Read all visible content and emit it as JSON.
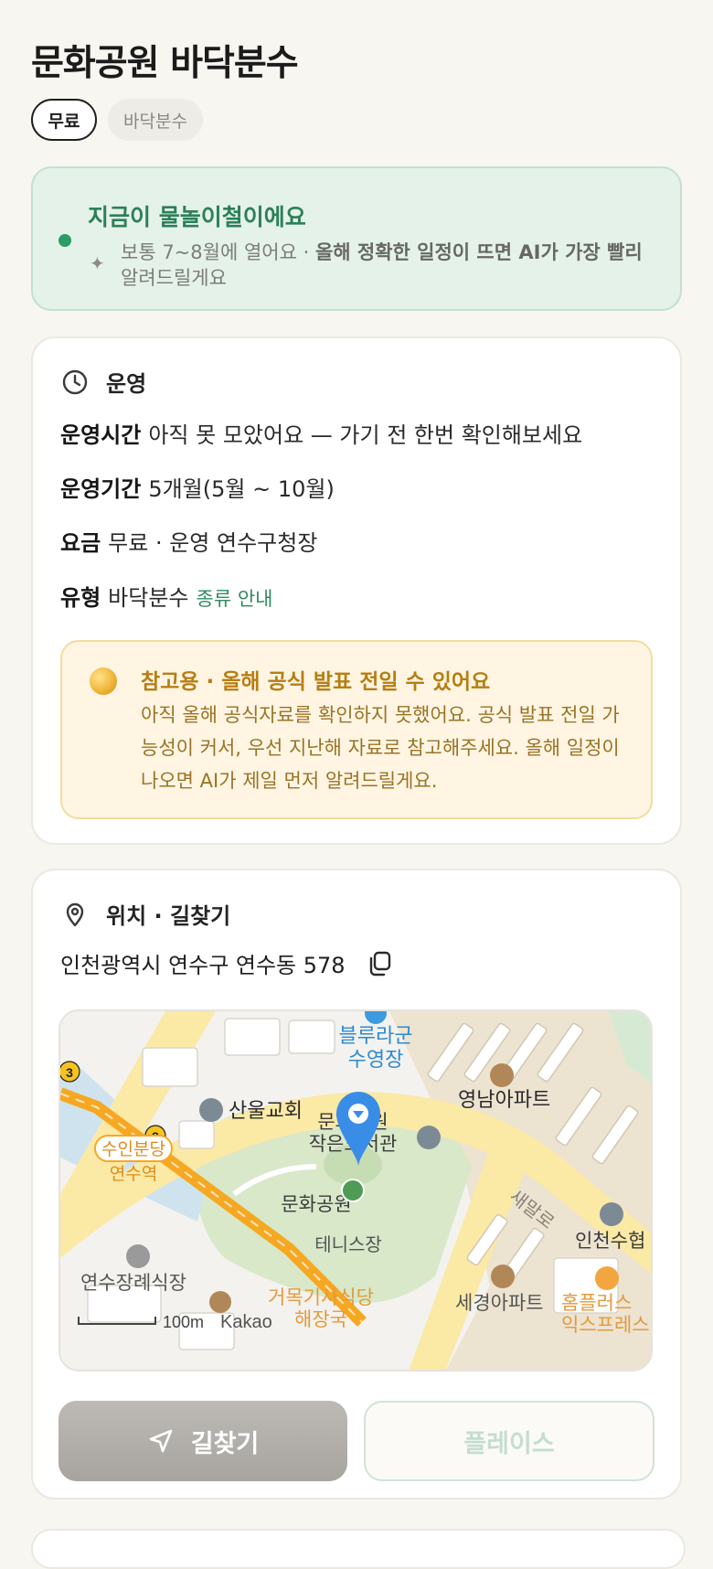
{
  "header": {
    "title": "문화공원 바닥분수",
    "chips": {
      "price": "무료",
      "type": "바닥분수"
    }
  },
  "season": {
    "title": "지금이 물놀이철이에요",
    "desc_prefix": "보통 7~8월에 열어요 · ",
    "desc_emphasis": "올해 정확한 일정이 뜨면 AI가 가장 빨리",
    "desc_suffix": " 알려드릴게요",
    "accent_color": "#2f9b68"
  },
  "operation": {
    "heading": "운영",
    "hours_label": "운영시간",
    "hours_value": "아직 못 모았어요 — 가기 전 한번 확인해보세요",
    "period_label": "운영기간",
    "period_value": "5개월(5월 ~ 10월)",
    "fee_label": "요금",
    "fee_value": "무료 · 운영 연수구청장",
    "type_label": "유형",
    "type_value": "바닥분수",
    "type_link": "종류 안내",
    "notice_title": "참고용 · 올해 공식 발표 전일 수 있어요",
    "notice_body": "아직 올해 공식자료를 확인하지 못했어요. 공식 발표 전일 가능성이 커서, 우선 지난해 자료로 참고해주세요. 올해 일정이 나오면 AI가 제일 먼저 알려드릴게요."
  },
  "location": {
    "heading": "위치 · 길찾기",
    "address": "인천광역시 연수구 연수동 578",
    "map_labels": {
      "pool": "블루라군 수영장",
      "church": "산울교회",
      "library": "문화공원 작은도서관",
      "park": "문화공원",
      "tennis": "테니스장",
      "apt1": "영남아파트",
      "apt2": "세경아파트",
      "road": "새말로",
      "station": "수인분당 연수역",
      "funeral": "연수장례식장",
      "market": "거목기사식당 해장국",
      "office": "인천수협",
      "store": "홈플러스 익스프레스",
      "scale": "100m",
      "brand": "Kakao",
      "line_no": "3"
    },
    "nav_button": "길찾기",
    "place_button": "플레이스"
  }
}
